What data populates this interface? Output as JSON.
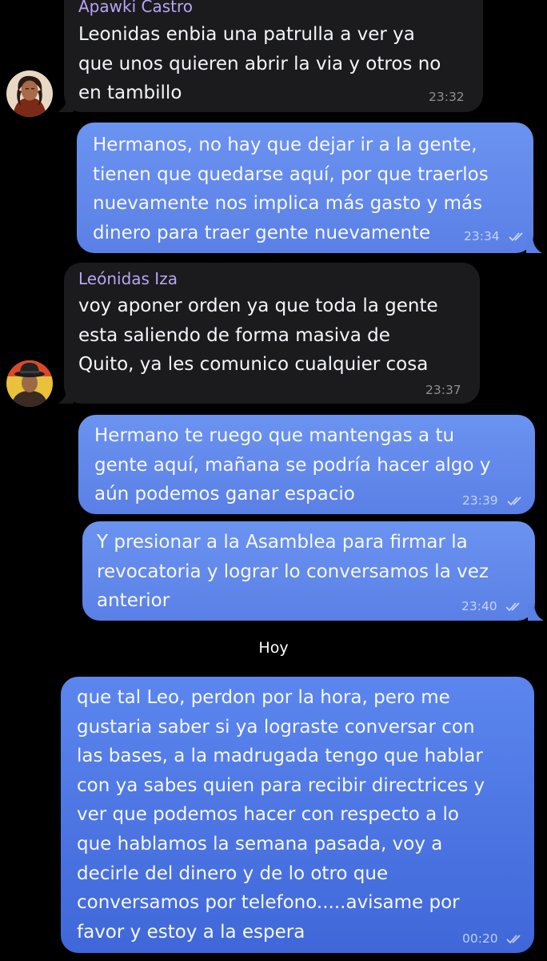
{
  "chat": {
    "date_separator": "Hoy",
    "messages": [
      {
        "direction": "incoming",
        "sender": "Apawki Castro",
        "text": "Leonidas enbia una patrulla a ver ya\nque unos quieren abrir la via y otros no\nen tambillo",
        "time": "23:32",
        "avatar": "avatar-apawki-castro"
      },
      {
        "direction": "outgoing",
        "text": "Hermanos, no hay que dejar ir a la gente,\ntienen que quedarse aquí, por que traerlos\nnuevamente nos implica más gasto y más\ndinero para traer gente nuevamente",
        "time": "23:34",
        "status": "read"
      },
      {
        "direction": "incoming",
        "sender": "Leónidas Iza",
        "text": "voy aponer orden ya que toda la gente\nesta saliendo de forma masiva de\nQuito, ya les comunico cualquier cosa",
        "time": "23:37",
        "avatar": "avatar-leonidas-iza"
      },
      {
        "direction": "outgoing",
        "text": "Hermano te ruego que mantengas a tu\ngente aquí, mañana se podría hacer algo y\naún podemos ganar espacio",
        "time": "23:39",
        "status": "read"
      },
      {
        "direction": "outgoing",
        "text": "Y presionar a la Asamblea para firmar la\nrevocatoria y lograr lo conversamos la vez\nanterior",
        "time": "23:40",
        "status": "read"
      },
      {
        "direction": "outgoing",
        "text": "que tal Leo, perdon por la hora, pero me\ngustaria saber si ya lograste conversar con\nlas bases, a la madrugada tengo que hablar\ncon ya sabes quien para recibir directrices y\nver que podemos hacer con respecto a lo\nque hablamos la semana pasada, voy a\ndecirle del dinero y de lo otro que\nconversamos por telefono.....avisame por\nfavor y estoy a la espera",
        "time": "00:20",
        "status": "read"
      }
    ]
  },
  "colors": {
    "background": "#000000",
    "incoming_bubble": "#1b1b1d",
    "outgoing_bubble": "#6b93f0",
    "sender_name": "#b9a4f5"
  }
}
